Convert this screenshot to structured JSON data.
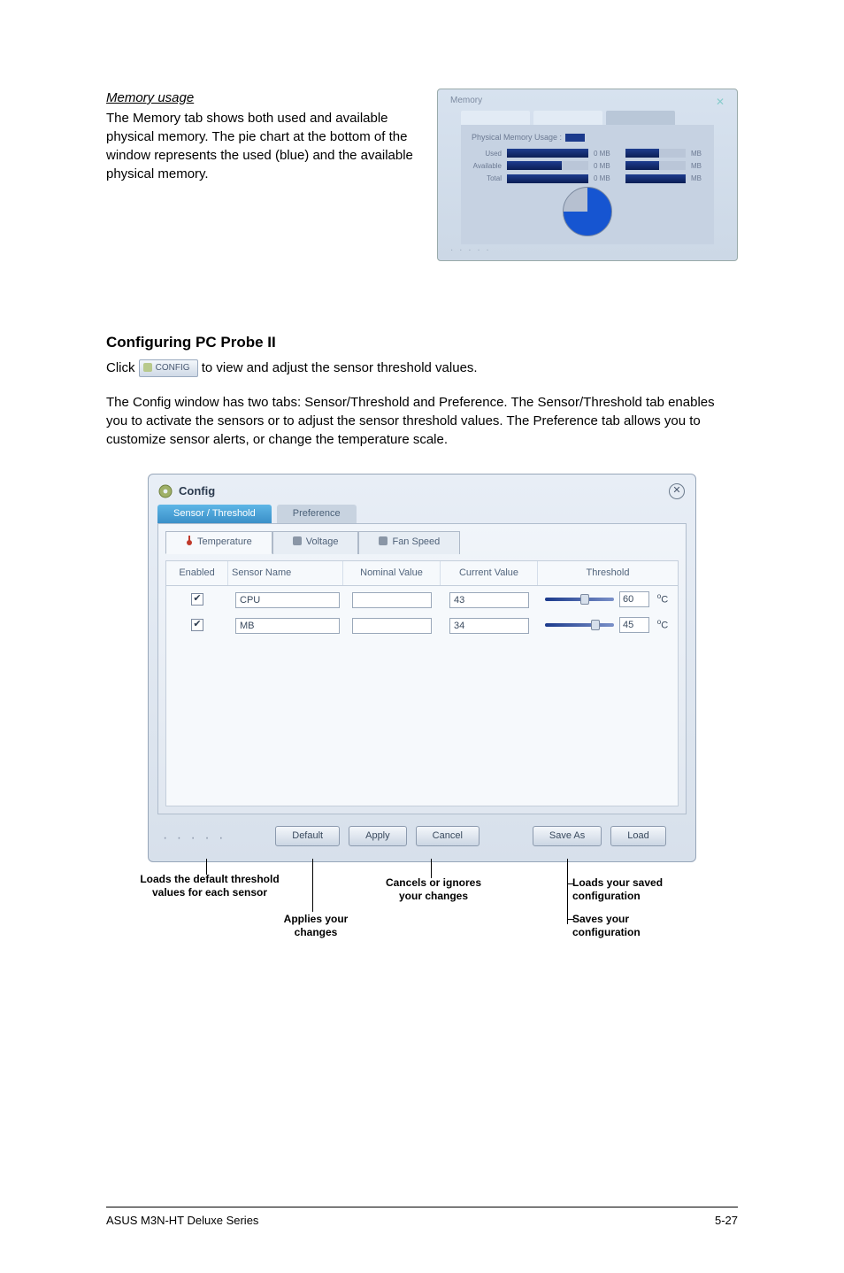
{
  "memory": {
    "heading": "Memory usage",
    "paragraph": "The Memory tab shows both used and available physical memory. The pie chart at the bottom of the window represents the used (blue) and the available physical memory.",
    "panel": {
      "title": "Memory",
      "close": "✕",
      "hdr": "Physical Memory Usage :",
      "rows": [
        {
          "label": "Used",
          "mid": "0 MB"
        },
        {
          "label": "Available",
          "mid": "0 MB"
        },
        {
          "label": "Total",
          "mid": "0 MB"
        }
      ]
    }
  },
  "configuring": {
    "heading": "Configuring PC Probe II",
    "click_before": "Click ",
    "config_btn": "CONFIG",
    "click_after": " to view and adjust the sensor threshold values.",
    "para": "The Config window has two tabs: Sensor/Threshold and Preference. The Sensor/Threshold tab enables you to activate the sensors or to adjust the sensor threshold values. The Preference tab allows you to customize sensor alerts, or change the temperature scale."
  },
  "config_window": {
    "title": "Config",
    "tabs1": {
      "t1": "Sensor / Threshold",
      "t2": "Preference"
    },
    "tabs2": {
      "temp": "Temperature",
      "volt": "Voltage",
      "fan": "Fan Speed"
    },
    "head": {
      "enabled": "Enabled",
      "sensor": "Sensor Name",
      "nominal": "Nominal Value",
      "current": "Current Value",
      "threshold": "Threshold"
    },
    "rows": [
      {
        "name": "CPU",
        "nominal": "",
        "current": "43",
        "threshold": "60",
        "knob": "46"
      },
      {
        "name": "MB",
        "nominal": "",
        "current": "34",
        "threshold": "45",
        "knob": "58"
      }
    ],
    "unit": "C",
    "buttons": {
      "default": "Default",
      "apply": "Apply",
      "cancel": "Cancel",
      "saveas": "Save As",
      "load": "Load"
    }
  },
  "callouts": {
    "left1": "Loads the default threshold values for each sensor",
    "left2": "Applies your changes",
    "mid": "Cancels or ignores your changes",
    "right1": "Loads your saved configuration",
    "right2": "Saves your configuration"
  },
  "footer": {
    "left": "ASUS M3N-HT Deluxe Series",
    "right": "5-27"
  }
}
